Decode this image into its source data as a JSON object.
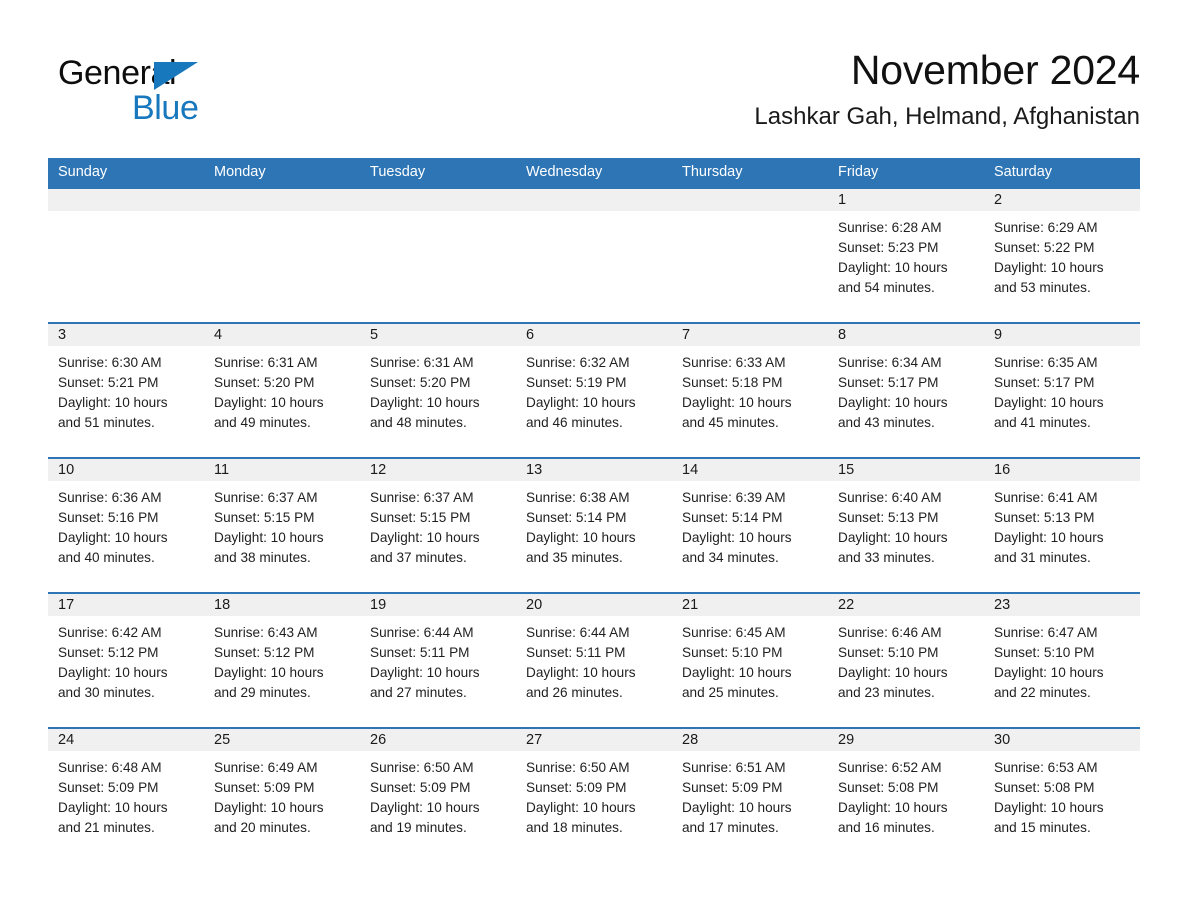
{
  "brand": {
    "line1": "General",
    "line2": "Blue",
    "triangle_icon": "triangle-icon",
    "color_dark": "#0d0d0d",
    "color_blue": "#1878bd"
  },
  "header": {
    "month_title": "November 2024",
    "location": "Lashkar Gah, Helmand, Afghanistan"
  },
  "theme": {
    "header_blue": "#2e75b5",
    "row_border_blue": "#2e75b5",
    "daynum_band": "#f0f0f0",
    "cell_bg": "#ffffff",
    "text": "#1f1f1f"
  },
  "weekdays": [
    "Sunday",
    "Monday",
    "Tuesday",
    "Wednesday",
    "Thursday",
    "Friday",
    "Saturday"
  ],
  "weeks": [
    [
      {
        "day": "",
        "lines": []
      },
      {
        "day": "",
        "lines": []
      },
      {
        "day": "",
        "lines": []
      },
      {
        "day": "",
        "lines": []
      },
      {
        "day": "",
        "lines": []
      },
      {
        "day": "1",
        "lines": [
          "Sunrise: 6:28 AM",
          "Sunset: 5:23 PM",
          "Daylight: 10 hours",
          "and 54 minutes."
        ]
      },
      {
        "day": "2",
        "lines": [
          "Sunrise: 6:29 AM",
          "Sunset: 5:22 PM",
          "Daylight: 10 hours",
          "and 53 minutes."
        ]
      }
    ],
    [
      {
        "day": "3",
        "lines": [
          "Sunrise: 6:30 AM",
          "Sunset: 5:21 PM",
          "Daylight: 10 hours",
          "and 51 minutes."
        ]
      },
      {
        "day": "4",
        "lines": [
          "Sunrise: 6:31 AM",
          "Sunset: 5:20 PM",
          "Daylight: 10 hours",
          "and 49 minutes."
        ]
      },
      {
        "day": "5",
        "lines": [
          "Sunrise: 6:31 AM",
          "Sunset: 5:20 PM",
          "Daylight: 10 hours",
          "and 48 minutes."
        ]
      },
      {
        "day": "6",
        "lines": [
          "Sunrise: 6:32 AM",
          "Sunset: 5:19 PM",
          "Daylight: 10 hours",
          "and 46 minutes."
        ]
      },
      {
        "day": "7",
        "lines": [
          "Sunrise: 6:33 AM",
          "Sunset: 5:18 PM",
          "Daylight: 10 hours",
          "and 45 minutes."
        ]
      },
      {
        "day": "8",
        "lines": [
          "Sunrise: 6:34 AM",
          "Sunset: 5:17 PM",
          "Daylight: 10 hours",
          "and 43 minutes."
        ]
      },
      {
        "day": "9",
        "lines": [
          "Sunrise: 6:35 AM",
          "Sunset: 5:17 PM",
          "Daylight: 10 hours",
          "and 41 minutes."
        ]
      }
    ],
    [
      {
        "day": "10",
        "lines": [
          "Sunrise: 6:36 AM",
          "Sunset: 5:16 PM",
          "Daylight: 10 hours",
          "and 40 minutes."
        ]
      },
      {
        "day": "11",
        "lines": [
          "Sunrise: 6:37 AM",
          "Sunset: 5:15 PM",
          "Daylight: 10 hours",
          "and 38 minutes."
        ]
      },
      {
        "day": "12",
        "lines": [
          "Sunrise: 6:37 AM",
          "Sunset: 5:15 PM",
          "Daylight: 10 hours",
          "and 37 minutes."
        ]
      },
      {
        "day": "13",
        "lines": [
          "Sunrise: 6:38 AM",
          "Sunset: 5:14 PM",
          "Daylight: 10 hours",
          "and 35 minutes."
        ]
      },
      {
        "day": "14",
        "lines": [
          "Sunrise: 6:39 AM",
          "Sunset: 5:14 PM",
          "Daylight: 10 hours",
          "and 34 minutes."
        ]
      },
      {
        "day": "15",
        "lines": [
          "Sunrise: 6:40 AM",
          "Sunset: 5:13 PM",
          "Daylight: 10 hours",
          "and 33 minutes."
        ]
      },
      {
        "day": "16",
        "lines": [
          "Sunrise: 6:41 AM",
          "Sunset: 5:13 PM",
          "Daylight: 10 hours",
          "and 31 minutes."
        ]
      }
    ],
    [
      {
        "day": "17",
        "lines": [
          "Sunrise: 6:42 AM",
          "Sunset: 5:12 PM",
          "Daylight: 10 hours",
          "and 30 minutes."
        ]
      },
      {
        "day": "18",
        "lines": [
          "Sunrise: 6:43 AM",
          "Sunset: 5:12 PM",
          "Daylight: 10 hours",
          "and 29 minutes."
        ]
      },
      {
        "day": "19",
        "lines": [
          "Sunrise: 6:44 AM",
          "Sunset: 5:11 PM",
          "Daylight: 10 hours",
          "and 27 minutes."
        ]
      },
      {
        "day": "20",
        "lines": [
          "Sunrise: 6:44 AM",
          "Sunset: 5:11 PM",
          "Daylight: 10 hours",
          "and 26 minutes."
        ]
      },
      {
        "day": "21",
        "lines": [
          "Sunrise: 6:45 AM",
          "Sunset: 5:10 PM",
          "Daylight: 10 hours",
          "and 25 minutes."
        ]
      },
      {
        "day": "22",
        "lines": [
          "Sunrise: 6:46 AM",
          "Sunset: 5:10 PM",
          "Daylight: 10 hours",
          "and 23 minutes."
        ]
      },
      {
        "day": "23",
        "lines": [
          "Sunrise: 6:47 AM",
          "Sunset: 5:10 PM",
          "Daylight: 10 hours",
          "and 22 minutes."
        ]
      }
    ],
    [
      {
        "day": "24",
        "lines": [
          "Sunrise: 6:48 AM",
          "Sunset: 5:09 PM",
          "Daylight: 10 hours",
          "and 21 minutes."
        ]
      },
      {
        "day": "25",
        "lines": [
          "Sunrise: 6:49 AM",
          "Sunset: 5:09 PM",
          "Daylight: 10 hours",
          "and 20 minutes."
        ]
      },
      {
        "day": "26",
        "lines": [
          "Sunrise: 6:50 AM",
          "Sunset: 5:09 PM",
          "Daylight: 10 hours",
          "and 19 minutes."
        ]
      },
      {
        "day": "27",
        "lines": [
          "Sunrise: 6:50 AM",
          "Sunset: 5:09 PM",
          "Daylight: 10 hours",
          "and 18 minutes."
        ]
      },
      {
        "day": "28",
        "lines": [
          "Sunrise: 6:51 AM",
          "Sunset: 5:09 PM",
          "Daylight: 10 hours",
          "and 17 minutes."
        ]
      },
      {
        "day": "29",
        "lines": [
          "Sunrise: 6:52 AM",
          "Sunset: 5:08 PM",
          "Daylight: 10 hours",
          "and 16 minutes."
        ]
      },
      {
        "day": "30",
        "lines": [
          "Sunrise: 6:53 AM",
          "Sunset: 5:08 PM",
          "Daylight: 10 hours",
          "and 15 minutes."
        ]
      }
    ]
  ]
}
